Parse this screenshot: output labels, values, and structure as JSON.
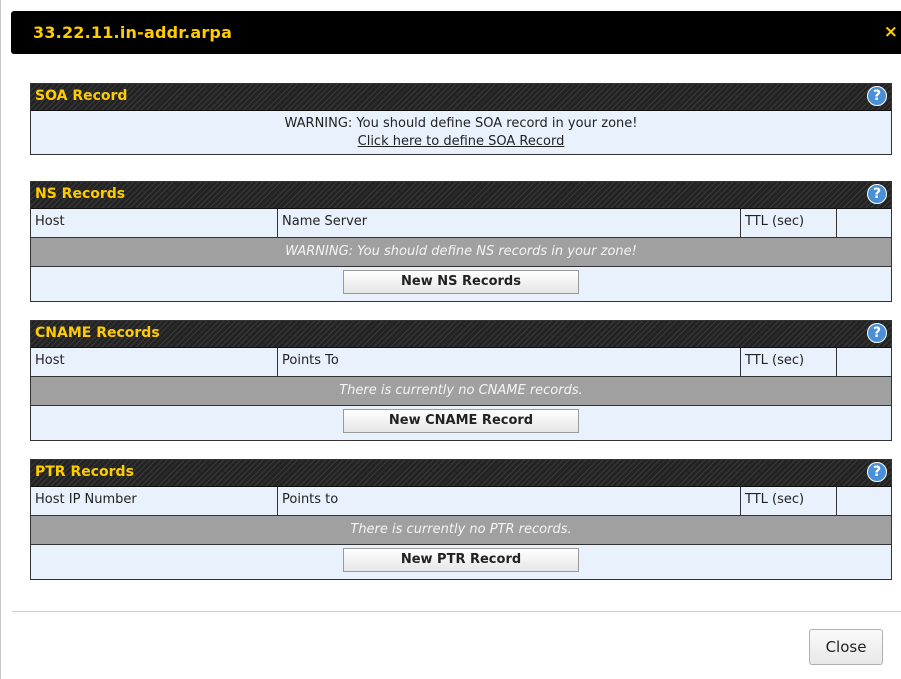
{
  "dialog": {
    "title": "33.22.11.in-addr.arpa",
    "close_icon": "×",
    "close_button_label": "Close"
  },
  "soa": {
    "title": "SOA Record",
    "warning": "WARNING: You should define SOA record in your zone!",
    "link": "Click here to define SOA Record"
  },
  "ns": {
    "title": "NS Records",
    "columns": [
      "Host",
      "Name Server",
      "TTL (sec)",
      ""
    ],
    "message": "WARNING: You should define NS records in your zone!",
    "button": "New NS Records"
  },
  "cname": {
    "title": "CNAME Records",
    "columns": [
      "Host",
      "Points To",
      "TTL (sec)",
      ""
    ],
    "message": "There is currently no CNAME records.",
    "button": "New CNAME Record"
  },
  "ptr": {
    "title": "PTR Records",
    "columns": [
      "Host IP Number",
      "Points to",
      "TTL (sec)",
      ""
    ],
    "message": "There is currently no PTR records.",
    "button": "New PTR Record"
  },
  "icons": {
    "help": "?"
  },
  "colors": {
    "title_text": "#ffcc00",
    "section_bg": "#e9f1fc",
    "message_bg": "#a0a0a0",
    "help_icon": "#4a90d9"
  }
}
